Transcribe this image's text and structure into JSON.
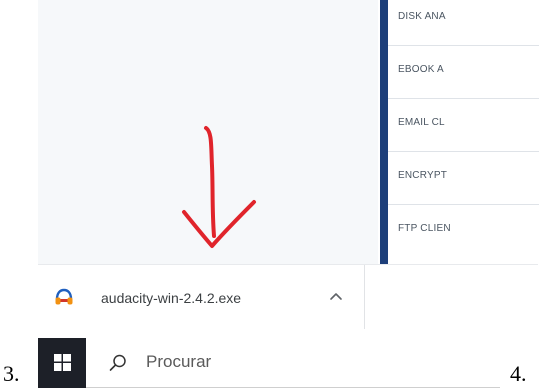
{
  "steps": {
    "left": "3.",
    "right": "4."
  },
  "categories": [
    "DISK ANA",
    "EBOOK A",
    "EMAIL CL",
    "ENCRYPT",
    "FTP CLIEN"
  ],
  "download": {
    "filename": "audacity-win-2.4.2.exe",
    "icon": "audacity-headphones-icon",
    "chevron": "chevron-up-icon"
  },
  "taskbar": {
    "start_icon": "windows-logo-icon",
    "search_placeholder": "Procurar",
    "search_icon": "search-icon"
  },
  "colors": {
    "accent_bar": "#1d3f7a",
    "annotation_red": "#e0242b",
    "taskbar_dark": "#1d2028"
  },
  "annotation": "red-hand-drawn-down-arrow"
}
